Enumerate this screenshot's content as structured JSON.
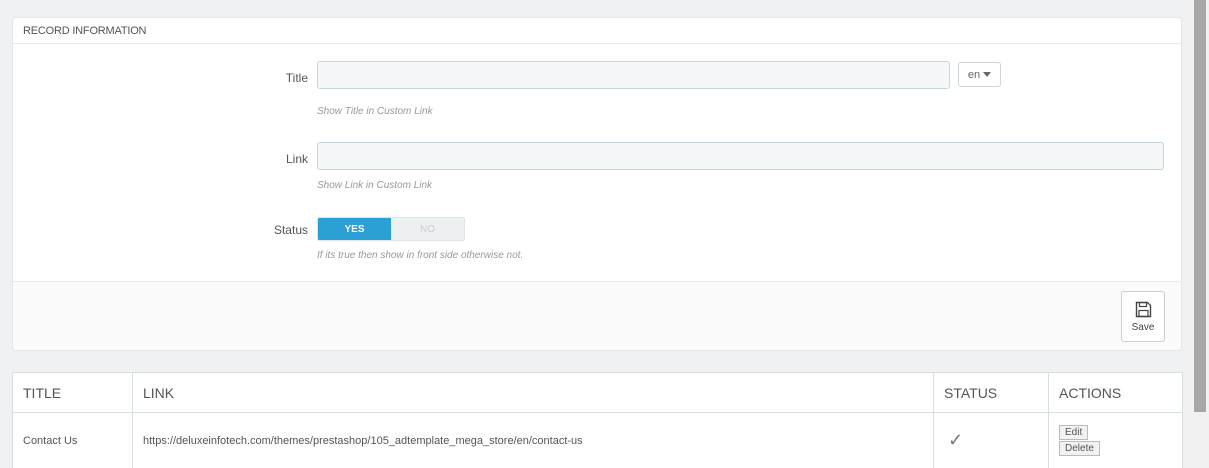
{
  "panel": {
    "heading": "RECORD INFORMATION",
    "title_field": {
      "label": "Title",
      "value": "",
      "help": "Show Title in Custom Link",
      "lang": "en"
    },
    "link_field": {
      "label": "Link",
      "value": "",
      "help": "Show Link in Custom Link"
    },
    "status_field": {
      "label": "Status",
      "yes": "YES",
      "no": "NO",
      "selected": "YES",
      "help": "If its true then show in front side otherwise not."
    },
    "save_label": "Save"
  },
  "table": {
    "headers": [
      "TITLE",
      "LINK",
      "STATUS",
      "ACTIONS"
    ],
    "rows": [
      {
        "title": "Contact Us",
        "link": "https://deluxeinfotech.com/themes/prestashop/105_adtemplate_mega_store/en/contact-us",
        "status": "✓",
        "edit": "Edit",
        "delete": "Delete"
      }
    ]
  },
  "icons": {
    "save": "floppy-disk-icon",
    "lang_caret": "caret-down-icon",
    "status": "checkmark-icon"
  },
  "colors": {
    "switch_active": "#2ba0d4",
    "background": "#eff1f2"
  }
}
